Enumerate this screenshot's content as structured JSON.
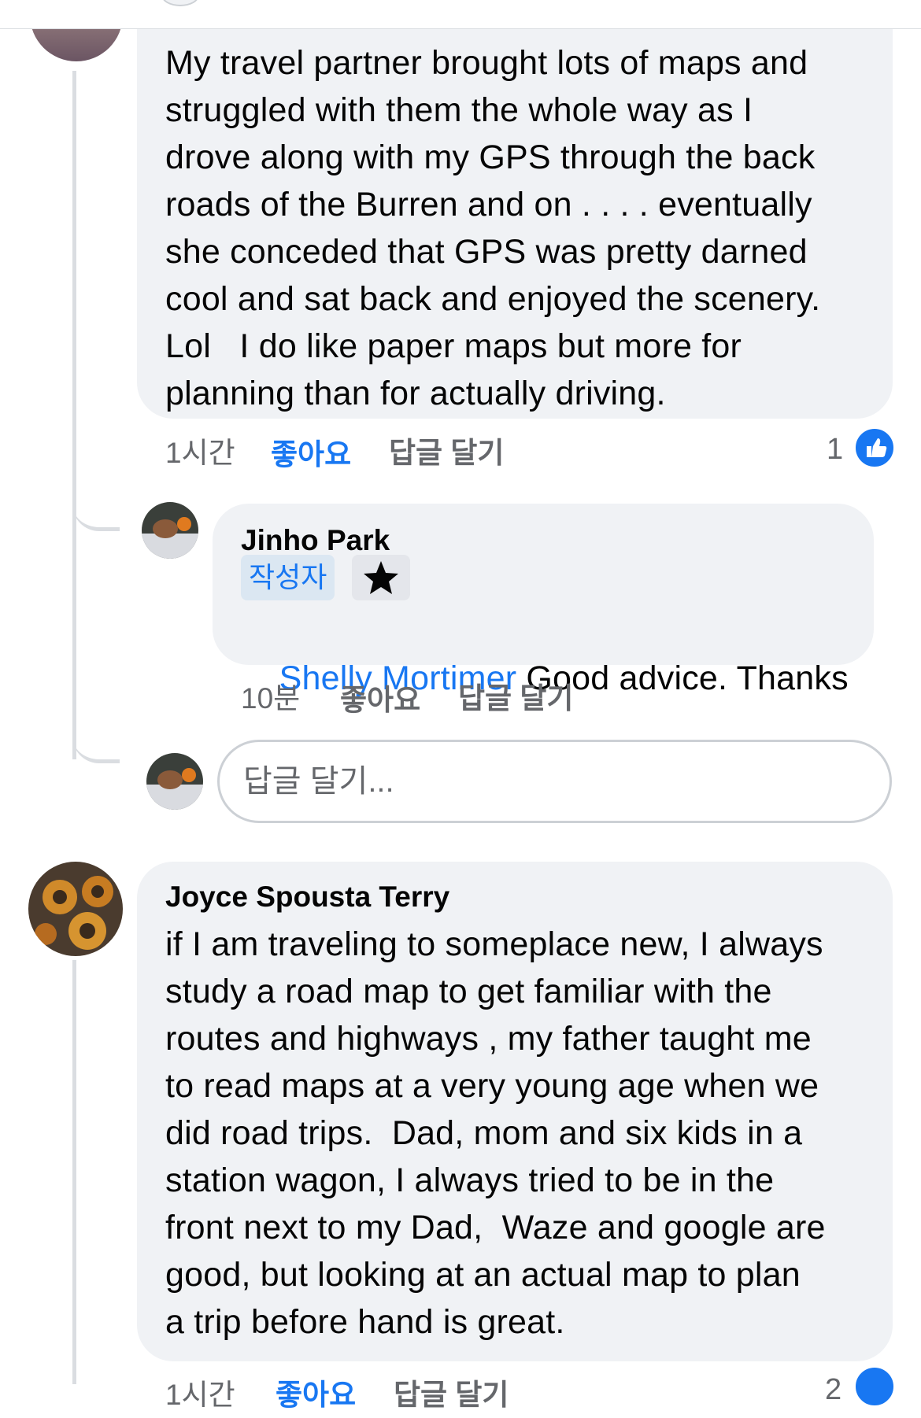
{
  "comments": [
    {
      "text": "My travel partner brought lots of maps and\nstruggled with them the whole way as I\ndrove along with my GPS through the back\nroads of the Burren and on . . . . eventually\nshe conceded that GPS was pretty darned\ncool and sat back and enjoyed the scenery.\nLol   I do like paper maps but more for\nplanning than for actually driving.",
      "time": "1시간",
      "like_label": "좋아요",
      "reply_label": "답글 달기",
      "reaction_count": "1"
    },
    {
      "author": "Jinho Park",
      "author_badge": "작성자",
      "mention": "Shelly Mortimer",
      "text": " Good advice. Thanks",
      "time": "10분",
      "like_label": "좋아요",
      "reply_label": "답글 달기"
    },
    {
      "author": "Joyce Spousta Terry",
      "text": "if I am traveling to someplace new, I always\nstudy a road map to get familiar with the\nroutes and highways , my father taught me\nto read maps at a very young age when we\ndid road trips.  Dad, mom and six kids in a\nstation wagon, I always tried to be in the\nfront next to my Dad,  Waze and google are\ngood, but looking at an actual map to plan\na trip before hand is great.",
      "time": "1시간",
      "like_label": "좋아요",
      "reply_label": "답글 달기",
      "reaction_count": "2"
    }
  ],
  "reply_input": {
    "placeholder": "답글 달기..."
  },
  "colors": {
    "link": "#1877f2",
    "bubble": "#f0f2f5",
    "muted": "#65676b",
    "author_badge_bg": "#dbe7f2"
  },
  "icons": {
    "star": "star-icon",
    "like": "thumbs-up-icon"
  }
}
